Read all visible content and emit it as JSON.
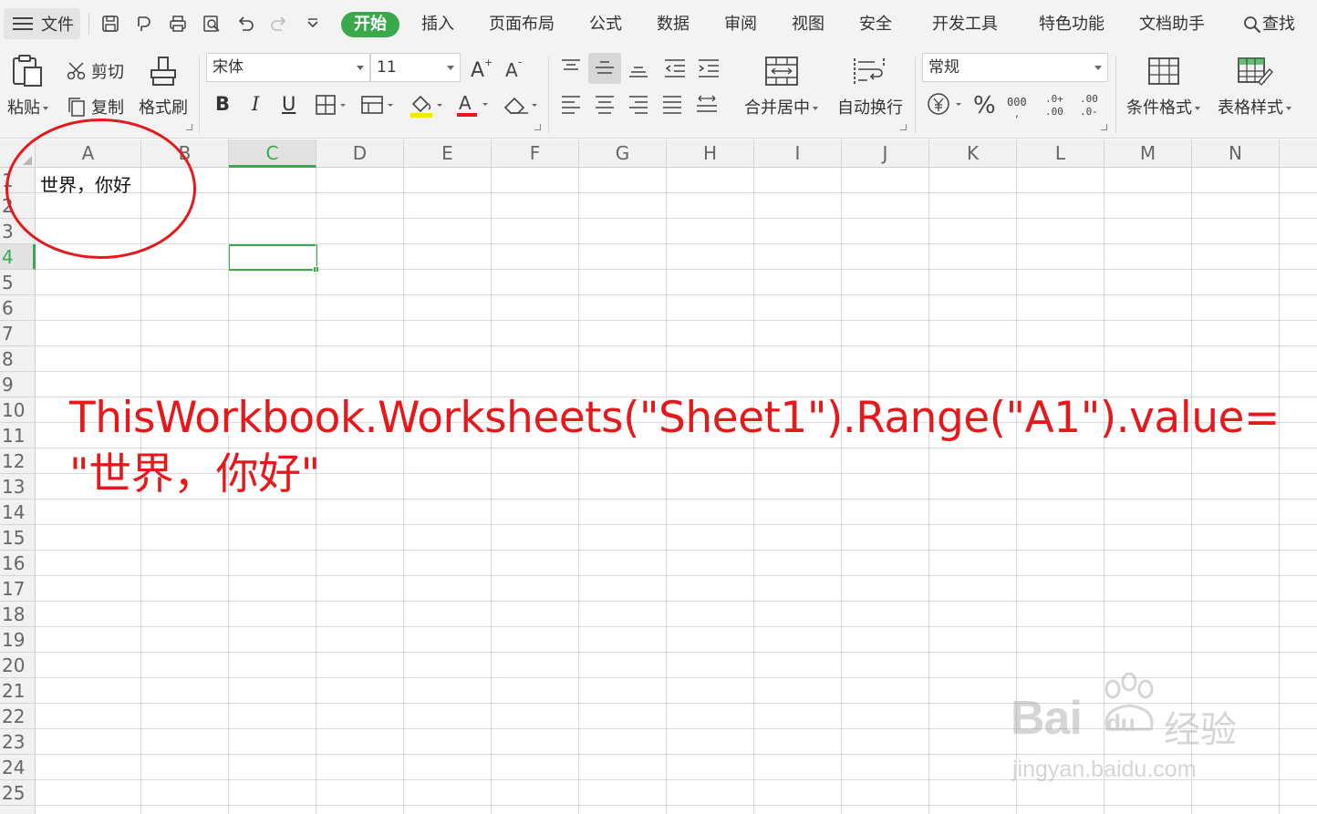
{
  "menubar": {
    "file_label": "文件",
    "tabs": [
      "开始",
      "插入",
      "页面布局",
      "公式",
      "数据",
      "审阅",
      "视图",
      "安全",
      "开发工具",
      "特色功能",
      "文档助手"
    ],
    "search_label": "查找"
  },
  "ribbon": {
    "paste_label": "粘贴",
    "cut_label": "剪切",
    "copy_label": "复制",
    "format_painter_label": "格式刷",
    "font_name": "宋体",
    "font_size": "11",
    "merge_center_label": "合并居中",
    "wrap_text_label": "自动换行",
    "number_format": "常规",
    "conditional_format_label": "条件格式",
    "table_style_label": "表格样式",
    "bold_label": "B",
    "italic_label": "I",
    "underline_label": "U",
    "font_color_label": "A"
  },
  "grid": {
    "columns": [
      "A",
      "B",
      "C",
      "D",
      "E",
      "F",
      "G",
      "H",
      "I",
      "J",
      "K",
      "L",
      "M",
      "N"
    ],
    "rows": [
      "1",
      "2",
      "3",
      "4",
      "5",
      "6",
      "7",
      "8",
      "9",
      "10",
      "11",
      "12",
      "13",
      "14",
      "15",
      "16",
      "17",
      "18",
      "19",
      "20",
      "21",
      "22",
      "23",
      "24",
      "25"
    ],
    "selected_column": "C",
    "selected_row": "4",
    "a1_value": "世界，你好"
  },
  "annotation": {
    "line1": "ThisWorkbook.Worksheets(\"Sheet1\").Range(\"A1\").value=",
    "line2": "\"世界，你好\"",
    "color": "#e5191c"
  },
  "watermark": {
    "brand": "Bai",
    "brand2": "du",
    "cn": "经验",
    "url": "jingyan.baidu.com"
  },
  "colors": {
    "accent": "#3aa94b",
    "annotation": "#e5191c"
  }
}
